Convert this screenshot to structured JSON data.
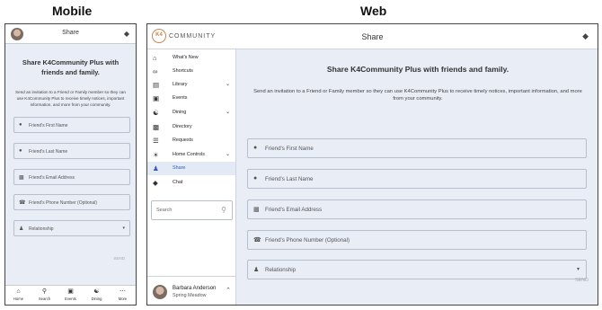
{
  "headings": {
    "mobile": "Mobile",
    "web": "Web"
  },
  "mobile": {
    "title": "Share",
    "heading": "Share K4Community Plus with friends and family.",
    "description": "Send an invitation to a Friend or Family member so they can use K4Community Plus to receive timely notices, important information, and more from your community.",
    "fields": {
      "first_name": "Friend's First Name",
      "last_name": "Friend's Last Name",
      "email": "Friend's Email Address",
      "phone": "Friend's Phone Number (Optional)",
      "relationship": "Relationship"
    },
    "send": "SEND",
    "tabs": [
      {
        "label": "Home",
        "icon": "home-icon"
      },
      {
        "label": "Search",
        "icon": "search-icon"
      },
      {
        "label": "Events",
        "icon": "calendar-icon"
      },
      {
        "label": "Dining",
        "icon": "utensils-icon"
      },
      {
        "label": "More",
        "icon": "more-icon"
      }
    ]
  },
  "web": {
    "logo_mark": "K4",
    "logo_text": "COMMUNITY",
    "title": "Share",
    "nav": [
      {
        "label": "What's New",
        "icon": "home-icon"
      },
      {
        "label": "Shortcuts",
        "icon": "link-icon"
      },
      {
        "label": "Library",
        "icon": "book-icon"
      },
      {
        "label": "Events",
        "icon": "calendar-icon"
      },
      {
        "label": "Dining",
        "icon": "utensils-icon"
      },
      {
        "label": "Directory",
        "icon": "id-card-icon"
      },
      {
        "label": "Requests",
        "icon": "list-icon"
      },
      {
        "label": "Home Controls",
        "icon": "lightbulb-icon"
      },
      {
        "label": "Share",
        "icon": "people-icon"
      },
      {
        "label": "Chat",
        "icon": "chat-icon"
      }
    ],
    "search_placeholder": "Search",
    "user": {
      "name": "Barbara Anderson",
      "location": "Spring Meadow"
    },
    "heading": "Share K4Community Plus with friends and family.",
    "description": "Send an invitation to a Friend or Family member so they can use K4Community Plus to receive timely notices, important information, and more from your community.",
    "fields": {
      "first_name": "Friend's First Name",
      "last_name": "Friend's Last Name",
      "email": "Friend's Email Address",
      "phone": "Friend's Phone Number (Optional)",
      "relationship": "Relationship"
    },
    "send": "SEND",
    "active_color": "#2f5bb5"
  }
}
